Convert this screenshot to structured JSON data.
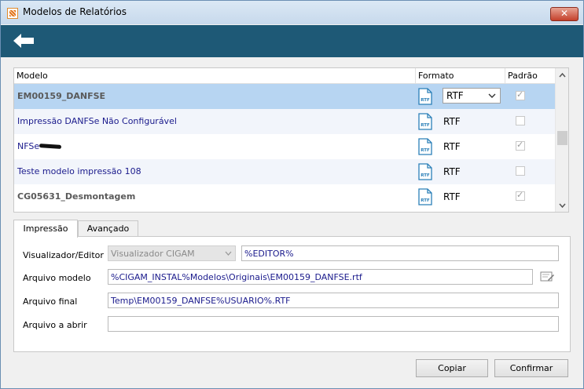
{
  "window": {
    "title": "Modelos de Relatórios",
    "close_label": "✕"
  },
  "grid": {
    "headers": {
      "modelo": "Modelo",
      "formato": "Formato",
      "padrao": "Padrão"
    },
    "format_icon_text": "RTF",
    "rows": [
      {
        "name": "EM00159_DANFSE",
        "format": "RTF",
        "default": true,
        "selected": true,
        "style": "bold-gray",
        "editor": true
      },
      {
        "name": "Impressão DANFSe Não Configurável",
        "format": "RTF",
        "default": false,
        "selected": false,
        "style": "blue"
      },
      {
        "name": "NFSe",
        "format": "RTF",
        "default": true,
        "selected": false,
        "style": "blue",
        "redacted": true
      },
      {
        "name": "Teste modelo impressão 108",
        "format": "RTF",
        "default": false,
        "selected": false,
        "style": "blue"
      },
      {
        "name": "CG05631_Desmontagem",
        "format": "RTF",
        "default": true,
        "selected": false,
        "style": "bold-gray"
      }
    ]
  },
  "tabs": [
    {
      "label": "Impressão",
      "active": true
    },
    {
      "label": "Avançado",
      "active": false
    }
  ],
  "form": {
    "visualizador_label": "Visualizador/Editor",
    "visualizador_value": "Visualizador CIGAM",
    "editor_value": "%EDITOR%",
    "arquivo_modelo_label": "Arquivo modelo",
    "arquivo_modelo_value": "%CIGAM_INSTAL%Modelos\\Originais\\EM00159_DANFSE.rtf",
    "arquivo_final_label": "Arquivo final",
    "arquivo_final_value": "Temp\\EM00159_DANFSE%USUARIO%.RTF",
    "arquivo_abrir_label": "Arquivo a abrir",
    "arquivo_abrir_value": ""
  },
  "buttons": {
    "copiar": "Copiar",
    "confirmar": "Confirmar"
  },
  "colors": {
    "toolbar": "#1e5976",
    "selected_row": "#b7d5f2",
    "alt_row": "#f2f5fb",
    "link_text": "#1a1a8c"
  }
}
